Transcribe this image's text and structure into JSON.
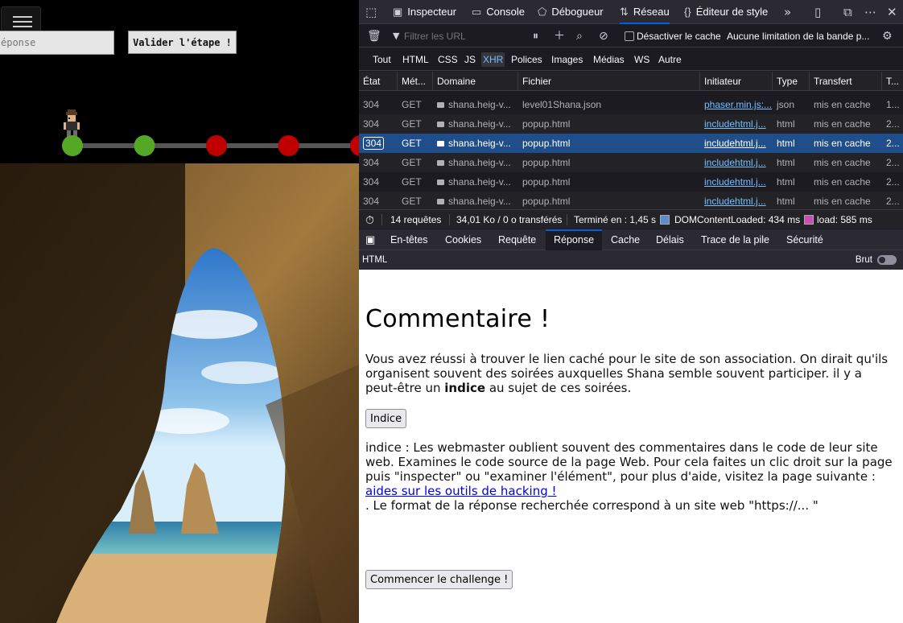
{
  "game": {
    "answer_placeholder": "éponse",
    "validate_label": "Valider l'étape !",
    "steps": [
      "done",
      "done",
      "todo",
      "todo",
      "todo"
    ]
  },
  "devtools": {
    "tabs": [
      {
        "label": "Inspecteur",
        "icon": "inspector-icon"
      },
      {
        "label": "Console",
        "icon": "console-icon"
      },
      {
        "label": "Débogueur",
        "icon": "debugger-icon"
      },
      {
        "label": "Réseau",
        "icon": "network-icon",
        "active": true
      },
      {
        "label": "Éditeur de style",
        "icon": "style-editor-icon"
      }
    ],
    "filter_placeholder": "Filtrer les URL",
    "disable_cache_label": "Désactiver le cache",
    "throttle_label": "Aucune limitation de la bande p...",
    "types": [
      "Tout",
      "HTML",
      "CSS",
      "JS",
      "XHR",
      "Polices",
      "Images",
      "Médias",
      "WS",
      "Autre"
    ],
    "active_type": "XHR",
    "columns": [
      "État",
      "Mét...",
      "Domaine",
      "Fichier",
      "Initiateur",
      "Type",
      "Transfert",
      "T..."
    ],
    "rows": [
      {
        "status": "304",
        "method": "GET",
        "domain": "shana.heig-v...",
        "file": "level01Shana.json",
        "initiator": "phaser.min.js:...",
        "type": "json",
        "transfer": "mis en cache",
        "t": "1..."
      },
      {
        "status": "304",
        "method": "GET",
        "domain": "shana.heig-v...",
        "file": "popup.html",
        "initiator": "includehtml.j...",
        "type": "html",
        "transfer": "mis en cache",
        "t": "2..."
      },
      {
        "status": "304",
        "method": "GET",
        "domain": "shana.heig-v...",
        "file": "popup.html",
        "initiator": "includehtml.j...",
        "type": "html",
        "transfer": "mis en cache",
        "t": "2...",
        "selected": true
      },
      {
        "status": "304",
        "method": "GET",
        "domain": "shana.heig-v...",
        "file": "popup.html",
        "initiator": "includehtml.j...",
        "type": "html",
        "transfer": "mis en cache",
        "t": "2..."
      },
      {
        "status": "304",
        "method": "GET",
        "domain": "shana.heig-v...",
        "file": "popup.html",
        "initiator": "includehtml.j...",
        "type": "html",
        "transfer": "mis en cache",
        "t": "2..."
      },
      {
        "status": "304",
        "method": "GET",
        "domain": "shana.heig-v...",
        "file": "popup.html",
        "initiator": "includehtml.j...",
        "type": "html",
        "transfer": "mis en cache",
        "t": "2..."
      }
    ],
    "summary": {
      "requests": "14 requêtes",
      "size": "34,01 Ko / 0 o transférés",
      "finished": "Terminé en : 1,45 s",
      "dcl": "DOMContentLoaded: 434 ms",
      "load": "load: 585 ms",
      "dcl_color": "#5b8ccc",
      "load_color": "#c850b0"
    },
    "detail_tabs": [
      "En-têtes",
      "Cookies",
      "Requête",
      "Réponse",
      "Cache",
      "Délais",
      "Trace de la pile",
      "Sécurité"
    ],
    "active_detail": "Réponse",
    "response_type": "HTML",
    "raw_label": "Brut"
  },
  "preview": {
    "title": "Commentaire !",
    "para1_before": "Vous avez réussi à trouver le lien caché pour le site de son association. On dirait qu'ils organisent souvent des soirées auxquelles Shana semble souvent participer. il y a peut-être un ",
    "para1_bold": "indice",
    "para1_after": " au sujet de ces soirées.",
    "hint_button": "Indice",
    "hint_text": "indice : Les webmaster oublient souvent des commentaires dans le code de leur site web. Examines le code source de la page Web. Pour cela faites un clic droit sur la page puis \"inspecter\" ou \"examiner l'élément\", pour plus d'aide, visitez la page suivante : ",
    "hint_link": "aides sur les outils de hacking !",
    "format_text": ". Le format de la réponse recherchée correspond à un site web \"https://... \"",
    "start_button": "Commencer le challenge !"
  }
}
